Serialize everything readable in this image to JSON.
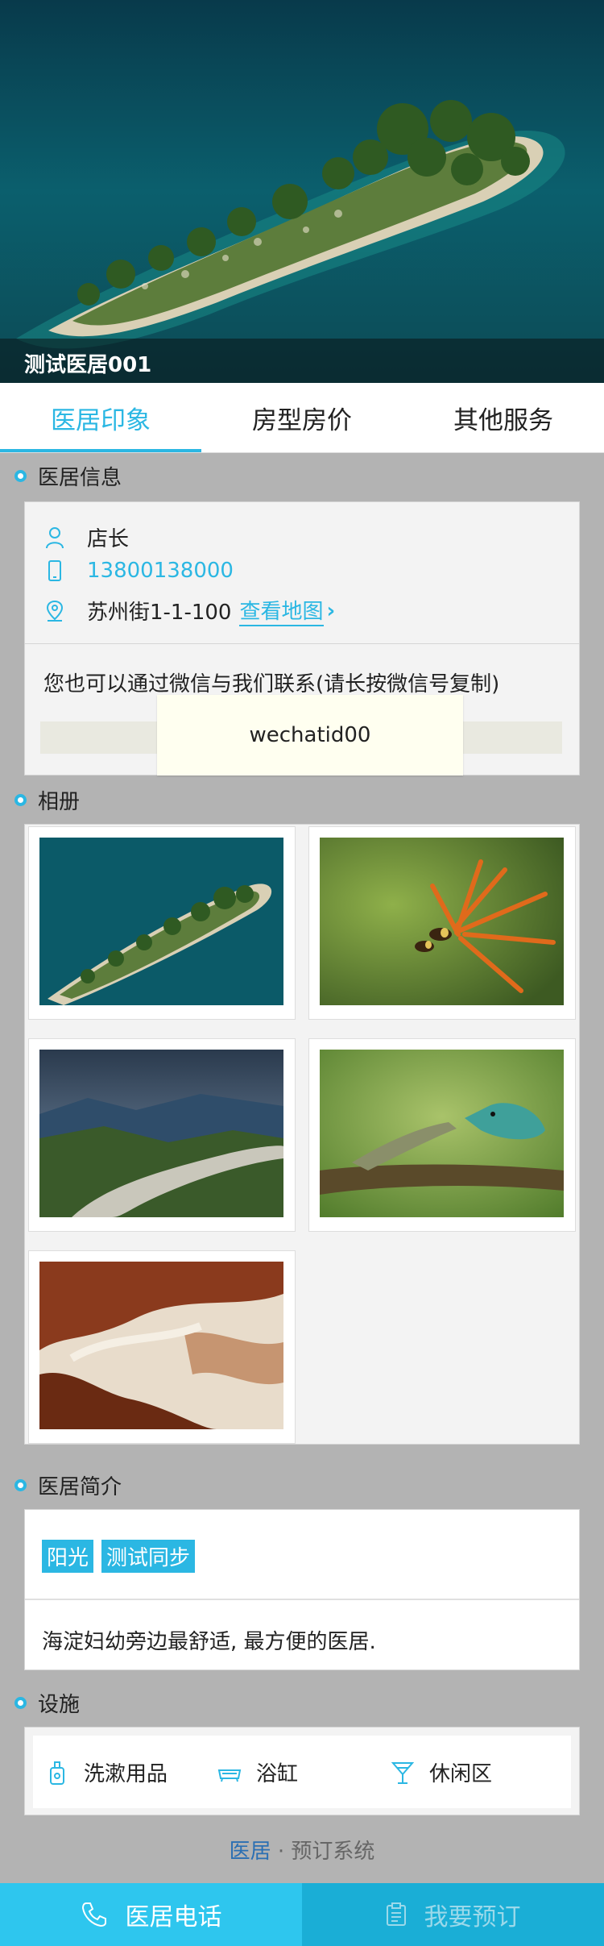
{
  "hero": {
    "title": "测试医居001"
  },
  "tabs": [
    {
      "label": "医居印象",
      "active": true
    },
    {
      "label": "房型房价",
      "active": false
    },
    {
      "label": "其他服务",
      "active": false
    }
  ],
  "info_section": {
    "heading": "医居信息",
    "manager": "店长",
    "phone": "13800138000",
    "address": "苏州街1-1-100",
    "map_link": "查看地图",
    "wechat_tip": "您也可以通过微信与我们联系(请长按微信号复制)",
    "wechat_id": "wechatid00"
  },
  "album": {
    "heading": "相册",
    "photos": [
      {
        "icon": "island-photo"
      },
      {
        "icon": "bees-flower-photo"
      },
      {
        "icon": "river-valley-photo"
      },
      {
        "icon": "lizards-photo"
      },
      {
        "icon": "marble-texture-photo"
      }
    ]
  },
  "intro": {
    "heading": "医居简介",
    "tags": [
      "阳光",
      "测试同步"
    ],
    "text": "海淀妇幼旁边最舒适, 最方便的医居."
  },
  "facilities": {
    "heading": "设施",
    "items": [
      {
        "label": "洗漱用品",
        "icon": "toiletries-icon"
      },
      {
        "label": "浴缸",
        "icon": "bathtub-icon"
      },
      {
        "label": "休闲区",
        "icon": "cocktail-icon"
      }
    ]
  },
  "footer": {
    "brand": "医居",
    "suffix": " · 预订系统"
  },
  "bottom_bar": {
    "call_label": "医居电话",
    "book_label": "我要预订"
  },
  "colors": {
    "accent": "#2bb7e3",
    "call_bg": "#2ec6ee",
    "book_bg": "#1aaed6"
  }
}
